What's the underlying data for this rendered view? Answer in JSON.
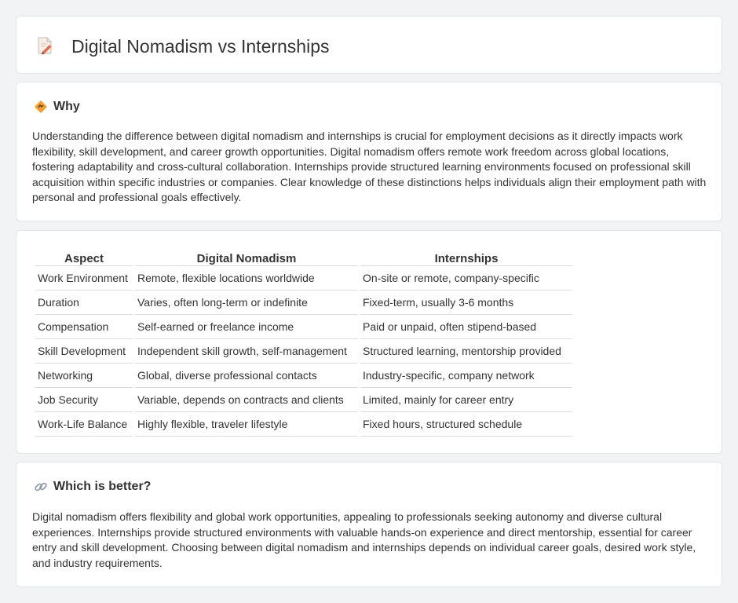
{
  "page": {
    "title": "Digital Nomadism vs Internships",
    "title_icon": "document-pencil-icon"
  },
  "why": {
    "heading": "Why",
    "icon": "diamond-sign-icon",
    "text": "Understanding the difference between digital nomadism and internships is crucial for employment decisions as it directly impacts work flexibility, skill development, and career growth opportunities. Digital nomadism offers remote work freedom across global locations, fostering adaptability and cross-cultural collaboration. Internships provide structured learning environments focused on professional skill acquisition within specific industries or companies. Clear knowledge of these distinctions helps individuals align their employment path with personal and professional goals effectively."
  },
  "comparison": {
    "headers": [
      "Aspect",
      "Digital Nomadism",
      "Internships"
    ],
    "rows": [
      [
        "Work Environment",
        "Remote, flexible locations worldwide",
        "On-site or remote, company-specific"
      ],
      [
        "Duration",
        "Varies, often long-term or indefinite",
        "Fixed-term, usually 3-6 months"
      ],
      [
        "Compensation",
        "Self-earned or freelance income",
        "Paid or unpaid, often stipend-based"
      ],
      [
        "Skill Development",
        "Independent skill growth, self-management",
        "Structured learning, mentorship provided"
      ],
      [
        "Networking",
        "Global, diverse professional contacts",
        "Industry-specific, company network"
      ],
      [
        "Job Security",
        "Variable, depends on contracts and clients",
        "Limited, mainly for career entry"
      ],
      [
        "Work-Life Balance",
        "Highly flexible, traveler lifestyle",
        "Fixed hours, structured schedule"
      ]
    ]
  },
  "better": {
    "heading": "Which is better?",
    "icon": "link-icon",
    "text": "Digital nomadism offers flexibility and global work opportunities, appealing to professionals seeking autonomy and diverse cultural experiences. Internships provide structured environments with valuable hands-on experience and direct mentorship, essential for career entry and skill development. Choosing between digital nomadism and internships depends on individual career goals, desired work style, and industry requirements."
  },
  "colors": {
    "background": "#f2f3f5",
    "card": "#ffffff",
    "text": "#333333",
    "accent_orange": "#f0a030"
  }
}
